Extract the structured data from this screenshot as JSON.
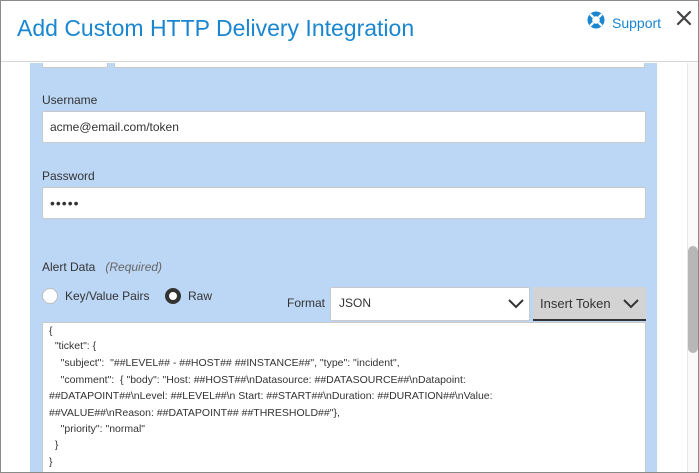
{
  "dialog": {
    "title": "Add Custom HTTP Delivery Integration",
    "support_label": "Support",
    "support_icon": "lifebuoy-icon",
    "close_icon": "close-icon",
    "accent_color": "#1a86d0",
    "panel_color": "#bcd7f5"
  },
  "form": {
    "username": {
      "label": "Username",
      "value": "acme@email.com/token"
    },
    "password": {
      "label": "Password",
      "value": "•••••"
    },
    "alert_data": {
      "label": "Alert Data",
      "required_note": "(Required)",
      "options": [
        {
          "label": "Key/Value Pairs",
          "selected": false
        },
        {
          "label": "Raw",
          "selected": true
        }
      ],
      "format_label": "Format",
      "format_value": "JSON",
      "insert_token_label": "Insert Token",
      "raw_lines": [
        "{",
        "  \"ticket\": {",
        "    \"subject\":  \"##LEVEL## - ##HOST## ##INSTANCE##\", \"type\": \"incident\",",
        "    \"comment\":  { \"body\": \"Host: ##HOST##\\nDatasource: ##DATASOURCE##\\nDatapoint:",
        "##DATAPOINT##\\nLevel: ##LEVEL##\\n Start: ##START##\\nDuration: ##DURATION##\\nValue:",
        "##VALUE##\\nReason: ##DATAPOINT## ##THRESHOLD##\"},",
        "    \"priority\": \"normal\"",
        "  }",
        "}"
      ]
    }
  }
}
